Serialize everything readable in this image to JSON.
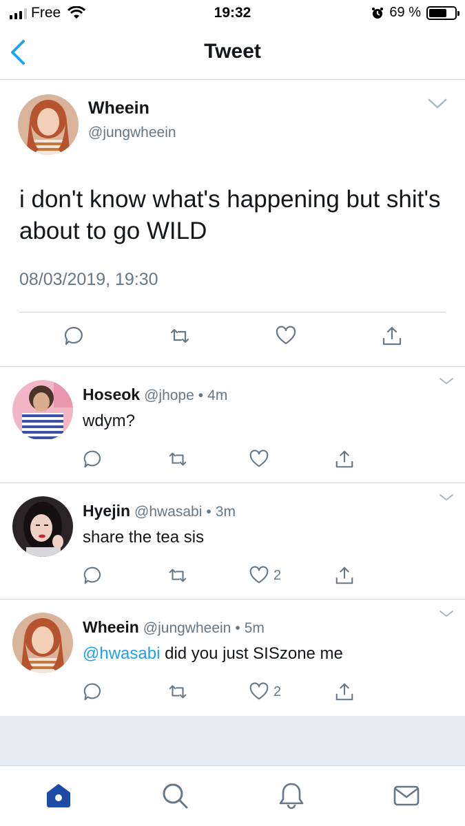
{
  "status_bar": {
    "carrier": "Free",
    "time": "19:32",
    "battery_percent": "69 %",
    "battery_level": 0.69
  },
  "nav": {
    "title": "Tweet"
  },
  "main_tweet": {
    "name": "Wheein",
    "handle": "@jungwheein",
    "text": "i don't know what's happening but shit's about to go WILD",
    "datetime": "08/03/2019, 19:30"
  },
  "replies": [
    {
      "name": "Hoseok",
      "handle": "@jhope",
      "time": "4m",
      "text": "wdym?",
      "mention": "",
      "like_count": ""
    },
    {
      "name": "Hyejin",
      "handle": "@hwasabi",
      "time": "3m",
      "text": "share the tea sis",
      "mention": "",
      "like_count": "2"
    },
    {
      "name": "Wheein",
      "handle": "@jungwheein",
      "time": "5m",
      "mention": "@hwasabi",
      "text": " did you just SISzone me",
      "like_count": "2"
    }
  ],
  "separator": "•",
  "icons": {
    "status": [
      "signal-icon",
      "wifi-icon",
      "alarm-icon",
      "battery-icon"
    ],
    "nav": [
      "back-chevron-icon"
    ],
    "actions": [
      "reply-icon",
      "retweet-icon",
      "like-icon",
      "share-icon",
      "chevron-down-icon"
    ],
    "tabs": [
      "home-icon",
      "search-icon",
      "notifications-icon",
      "messages-icon"
    ]
  },
  "colors": {
    "accent": "#1da1f2",
    "secondary_text": "#657786",
    "primary_text": "#14171a",
    "divider": "#cfd6db",
    "background_gray": "#e6ecf0",
    "home_active": "#1c4aa6"
  }
}
